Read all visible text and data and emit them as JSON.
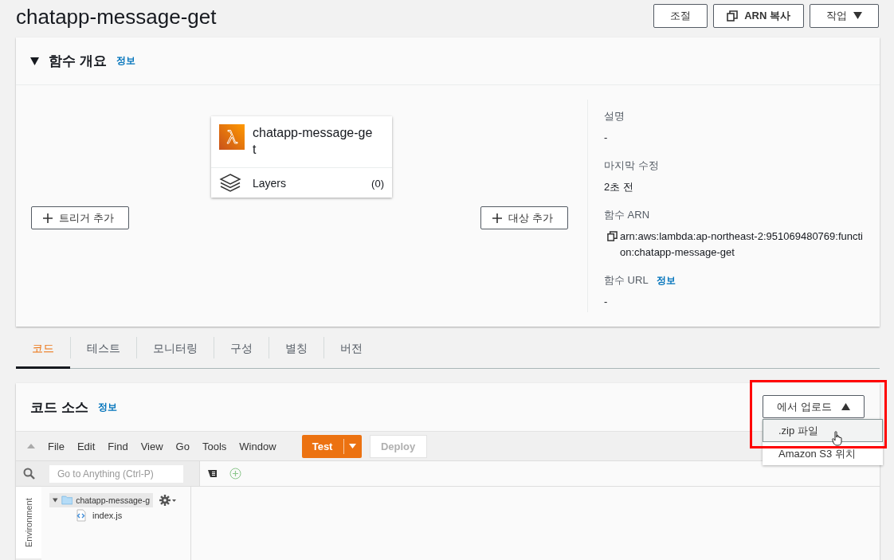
{
  "page_title": "chatapp-message-get",
  "header_buttons": [
    {
      "kind": "plain",
      "label": "조절"
    },
    {
      "kind": "copy",
      "label": "ARN 복사"
    },
    {
      "kind": "dropdown",
      "label": "작업"
    }
  ],
  "overview": {
    "title": "함수 개요",
    "expanded": true,
    "info_link": "정보",
    "function": {
      "name": "chatapp-message-get",
      "layers_label": "Layers",
      "layers_count": "(0)"
    },
    "add_trigger": "트리거 추가",
    "add_destination": "대상 추가",
    "details": [
      {
        "kind": "text",
        "label": "설명",
        "value": "-"
      },
      {
        "kind": "text",
        "label": "마지막 수정",
        "value": "2초 전"
      },
      {
        "kind": "copyable",
        "label": "함수 ARN",
        "value": "arn:aws:lambda:ap-northeast-2:951069480769:function:chatapp-message-get"
      },
      {
        "kind": "text",
        "label": "함수 URL",
        "info_link": "정보",
        "value": "-"
      }
    ]
  },
  "tabs": [
    {
      "label": "코드",
      "selected": true
    },
    {
      "label": "테스트",
      "selected": false
    },
    {
      "label": "모니터링",
      "selected": false
    },
    {
      "label": "구성",
      "selected": false
    },
    {
      "label": "별칭",
      "selected": false
    },
    {
      "label": "버전",
      "selected": false
    }
  ],
  "code_source": {
    "title": "코드 소스",
    "info_link": "정보",
    "upload_button": {
      "label": "에서 업로드",
      "expanded": true
    },
    "upload_menu": [
      {
        "label": ".zip 파일",
        "selected": true
      },
      {
        "label": "Amazon S3 위치",
        "selected": false
      }
    ],
    "menu": [
      "File",
      "Edit",
      "Find",
      "View",
      "Go",
      "Tools",
      "Window"
    ],
    "test_button": "Test",
    "deploy_button": {
      "label": "Deploy",
      "disabled": true
    },
    "search": {
      "placeholder": "Go to Anything (Ctrl-P)"
    },
    "side_tab": "Environment",
    "tree": [
      {
        "name": "chatapp-message-g",
        "expanded": true,
        "selected": true,
        "children": [
          {
            "name": "index.js",
            "selected": false
          }
        ]
      }
    ]
  }
}
